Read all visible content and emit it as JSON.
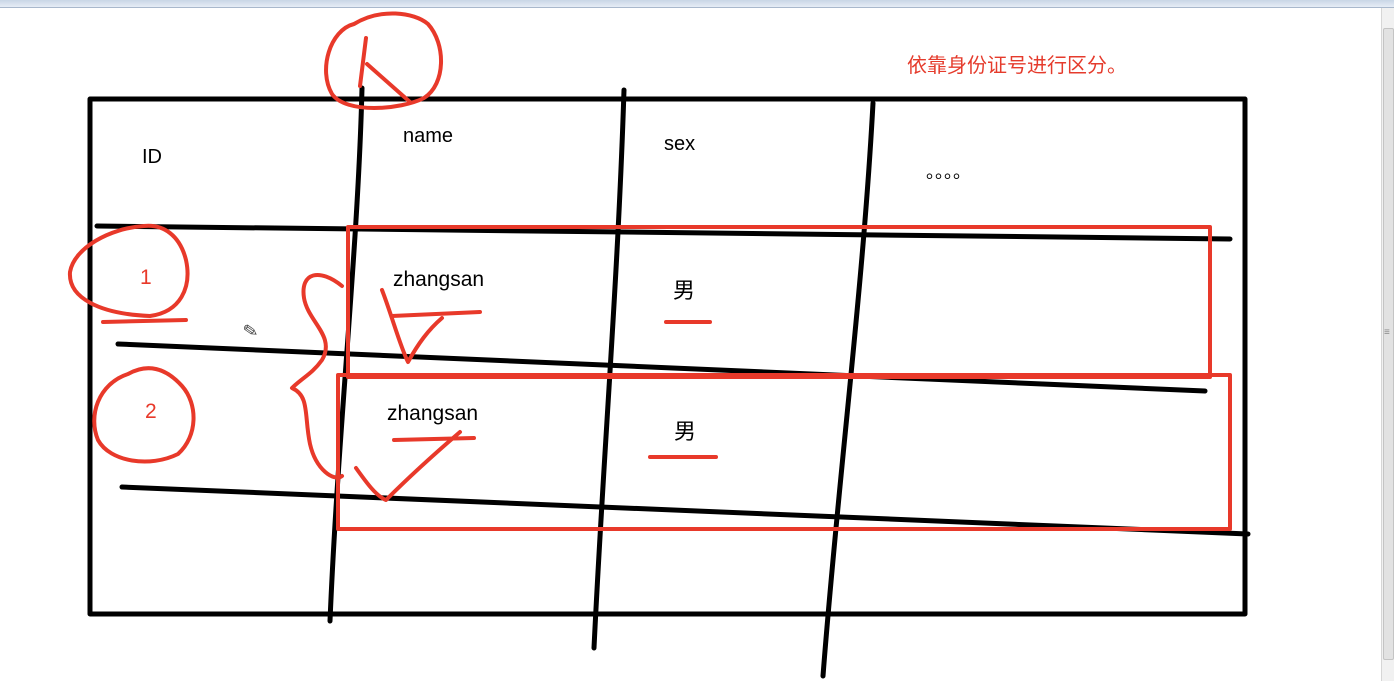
{
  "annotation_note": "依靠身份证号进行区分。",
  "table": {
    "headers": {
      "id": "ID",
      "name": "name",
      "sex": "sex",
      "more": "。。。。"
    },
    "rows": [
      {
        "id": "1",
        "name": "zhangsan",
        "sex": "男"
      },
      {
        "id": "2",
        "name": "zhangsan",
        "sex": "男"
      }
    ]
  },
  "cursor": {
    "icon": "pencil-icon"
  },
  "colors": {
    "ink": "#000000",
    "marker": "#e8392a"
  }
}
